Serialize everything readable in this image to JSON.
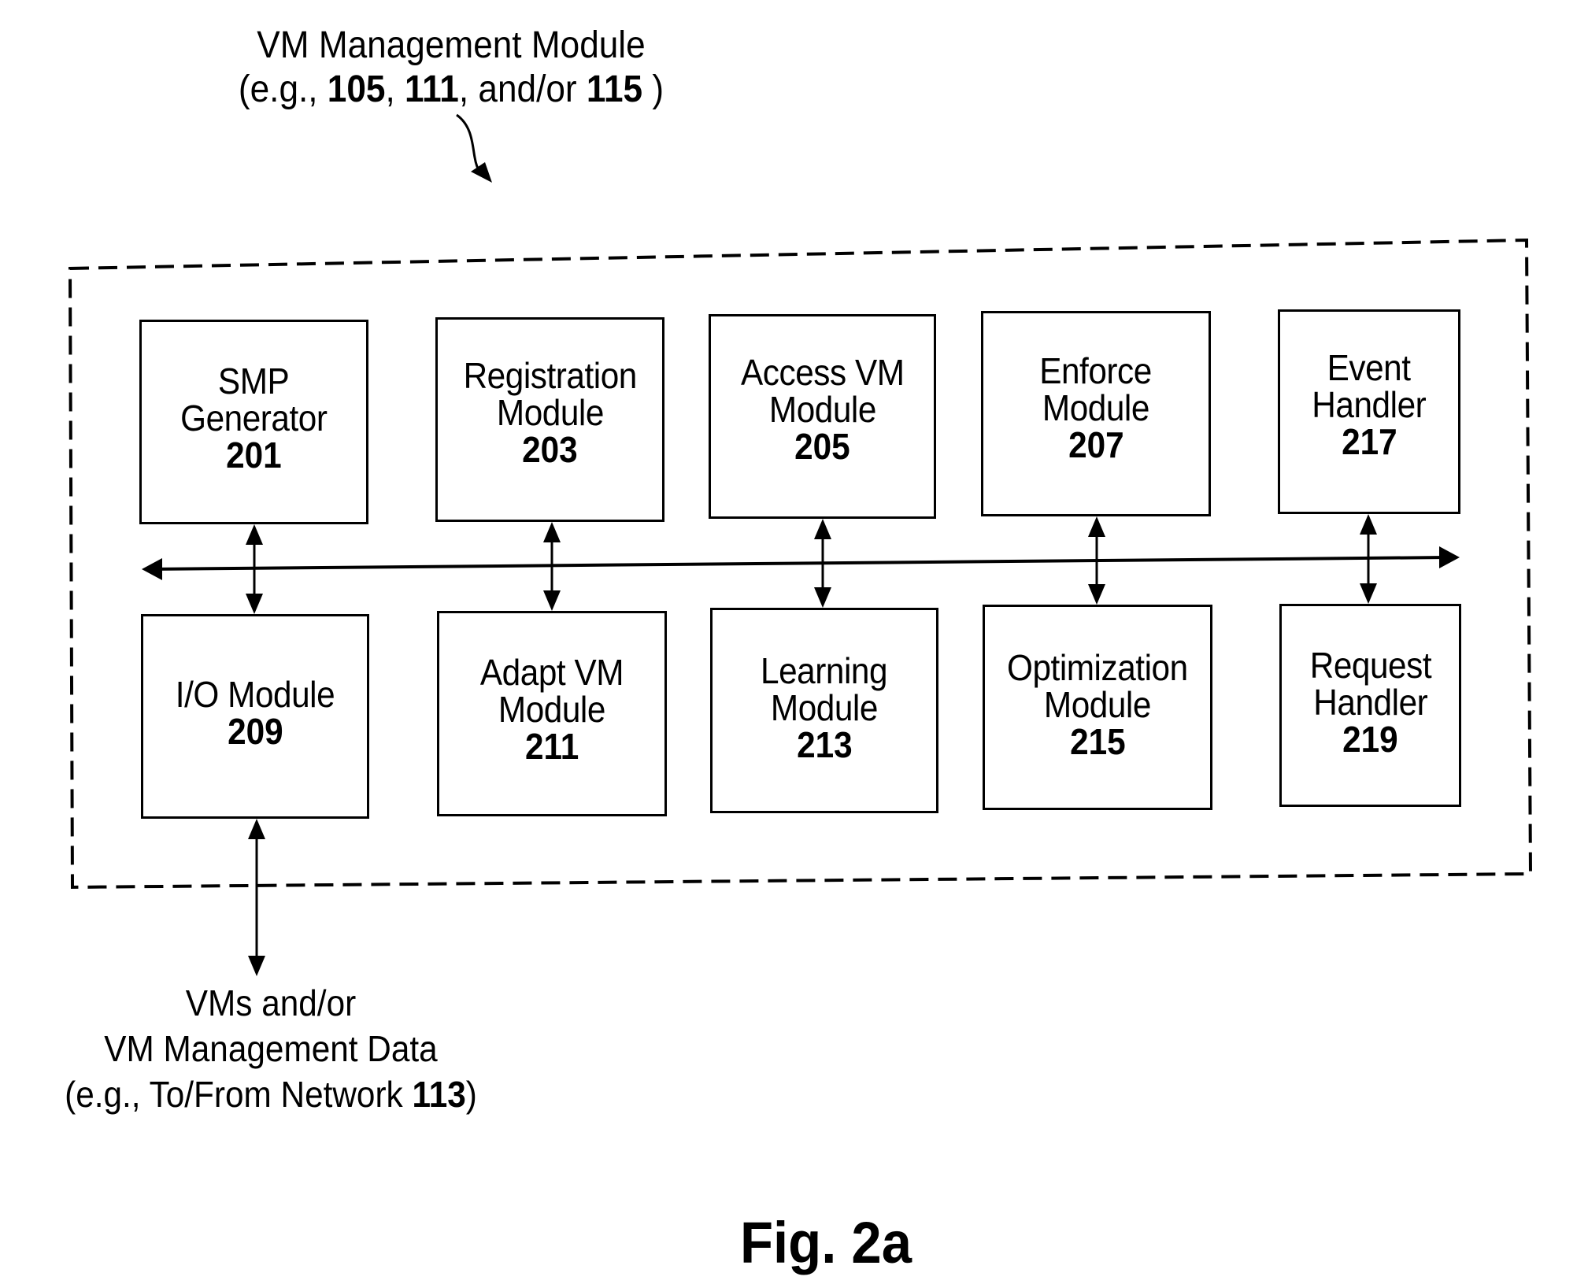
{
  "header": {
    "title_line1": "VM Management Module",
    "title_line2_prefix": "(e.g., ",
    "title_ref1": "105",
    "title_sep1": ", ",
    "title_ref2": "111",
    "title_sep2": ", and/or ",
    "title_ref3": "115",
    "title_suffix": " )"
  },
  "modules": {
    "top": [
      {
        "lines": [
          "SMP",
          "Generator"
        ],
        "ref": "201"
      },
      {
        "lines": [
          "Registration",
          "Module"
        ],
        "ref": "203"
      },
      {
        "lines": [
          "Access VM",
          "Module"
        ],
        "ref": "205"
      },
      {
        "lines": [
          "Enforce",
          "Module"
        ],
        "ref": "207"
      },
      {
        "lines": [
          "Event",
          "Handler"
        ],
        "ref": "217"
      }
    ],
    "bottom": [
      {
        "lines": [
          "I/O Module"
        ],
        "ref": "209"
      },
      {
        "lines": [
          "Adapt VM",
          "Module"
        ],
        "ref": "211"
      },
      {
        "lines": [
          "Learning",
          "Module"
        ],
        "ref": "213"
      },
      {
        "lines": [
          "Optimization",
          "Module"
        ],
        "ref": "215"
      },
      {
        "lines": [
          "Request",
          "Handler"
        ],
        "ref": "219"
      }
    ]
  },
  "external": {
    "line1": "VMs and/or",
    "line2": "VM Management Data",
    "line3_prefix": "(e.g., To/From Network ",
    "line3_ref": "113",
    "line3_suffix": ")"
  },
  "caption": "Fig. 2a"
}
